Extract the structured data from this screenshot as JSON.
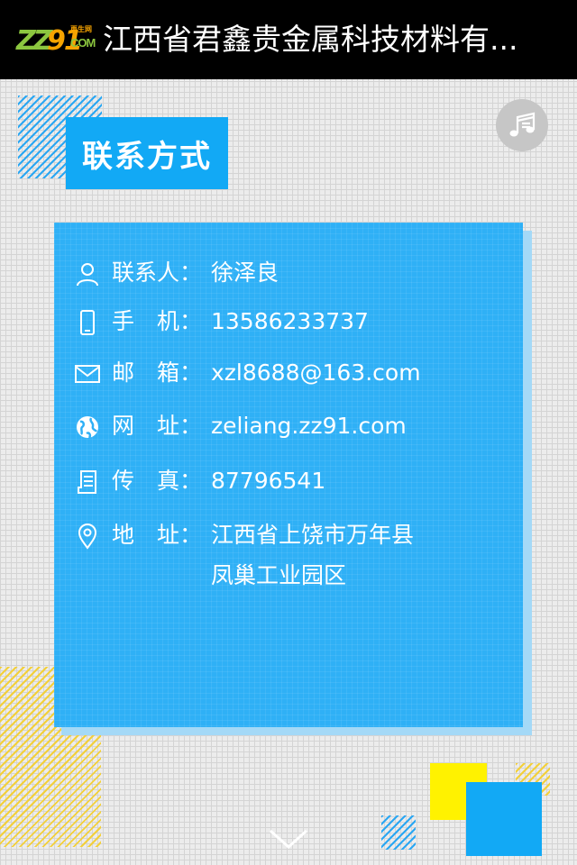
{
  "header": {
    "logo": {
      "zz": "ZZ",
      "n91": "91",
      "tagline": "再生网",
      "com": "COM"
    },
    "title": "江西省君鑫贵金属科技材料有..."
  },
  "section": {
    "label": "联系方式"
  },
  "contact": {
    "person": {
      "label": "联系人：",
      "value": "徐泽良",
      "icon": "person-icon"
    },
    "mobile": {
      "label": "手　机：",
      "value": "13586233737",
      "icon": "phone-icon"
    },
    "email": {
      "label": "邮　箱：",
      "value": " xzl8688@163.com",
      "icon": "mail-icon"
    },
    "website": {
      "label": "网　址：",
      "value": "zeliang.zz91.com",
      "icon": "globe-icon"
    },
    "fax": {
      "label": "传　真：",
      "value": "87796541",
      "icon": "fax-icon"
    },
    "address": {
      "label": "地　址：",
      "line1": "江西省上饶市万年县",
      "line2": "凤巢工业园区",
      "icon": "location-pin-icon"
    }
  },
  "colors": {
    "accent": "#12a9f5",
    "card": "#2fb0f6",
    "yellow": "#fff200"
  }
}
